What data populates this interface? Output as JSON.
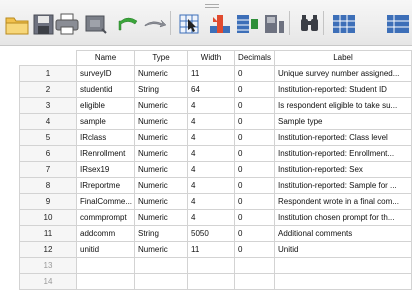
{
  "toolbar": {
    "buttons": [
      {
        "name": "open-icon"
      },
      {
        "name": "save-icon"
      },
      {
        "name": "print-icon"
      },
      {
        "name": "dialog-recall-icon"
      },
      {
        "name": "undo-icon"
      },
      {
        "name": "redo-icon"
      },
      {
        "name": "go-to-case-icon"
      },
      {
        "name": "go-to-variable-icon"
      },
      {
        "name": "variables-icon"
      },
      {
        "name": "run-descriptive-icon"
      },
      {
        "name": "find-icon"
      },
      {
        "name": "insert-cases-icon"
      }
    ]
  },
  "grid": {
    "headers": {
      "name": "Name",
      "type": "Type",
      "width": "Width",
      "decimals": "Decimals",
      "label": "Label"
    },
    "rows": [
      {
        "n": "1",
        "name": "surveyID",
        "type": "Numeric",
        "width": "11",
        "decimals": "0",
        "label": "Unique survey number assigned..."
      },
      {
        "n": "2",
        "name": "studentid",
        "type": "String",
        "width": "64",
        "decimals": "0",
        "label": "Institution-reported: Student ID"
      },
      {
        "n": "3",
        "name": "eligible",
        "type": "Numeric",
        "width": "4",
        "decimals": "0",
        "label": "Is respondent eligible to take su..."
      },
      {
        "n": "4",
        "name": "sample",
        "type": "Numeric",
        "width": "4",
        "decimals": "0",
        "label": "Sample type"
      },
      {
        "n": "5",
        "name": "IRclass",
        "type": "Numeric",
        "width": "4",
        "decimals": "0",
        "label": "Institution-reported: Class level"
      },
      {
        "n": "6",
        "name": "IRenrollment",
        "type": "Numeric",
        "width": "4",
        "decimals": "0",
        "label": "Institution-reported: Enrollment..."
      },
      {
        "n": "7",
        "name": "IRsex19",
        "type": "Numeric",
        "width": "4",
        "decimals": "0",
        "label": "Institution-reported: Sex"
      },
      {
        "n": "8",
        "name": "IRreportme",
        "type": "Numeric",
        "width": "4",
        "decimals": "0",
        "label": "Institution-reported: Sample for ..."
      },
      {
        "n": "9",
        "name": "FinalComme...",
        "type": "Numeric",
        "width": "4",
        "decimals": "0",
        "label": "Respondent wrote in a final com..."
      },
      {
        "n": "10",
        "name": "commprompt",
        "type": "Numeric",
        "width": "4",
        "decimals": "0",
        "label": "Institution chosen prompt for th..."
      },
      {
        "n": "11",
        "name": "addcomm",
        "type": "String",
        "width": "5050",
        "decimals": "0",
        "label": "Additional comments"
      },
      {
        "n": "12",
        "name": "unitid",
        "type": "Numeric",
        "width": "11",
        "decimals": "0",
        "label": "Unitid"
      }
    ],
    "empty_rows": [
      "13",
      "14"
    ]
  }
}
